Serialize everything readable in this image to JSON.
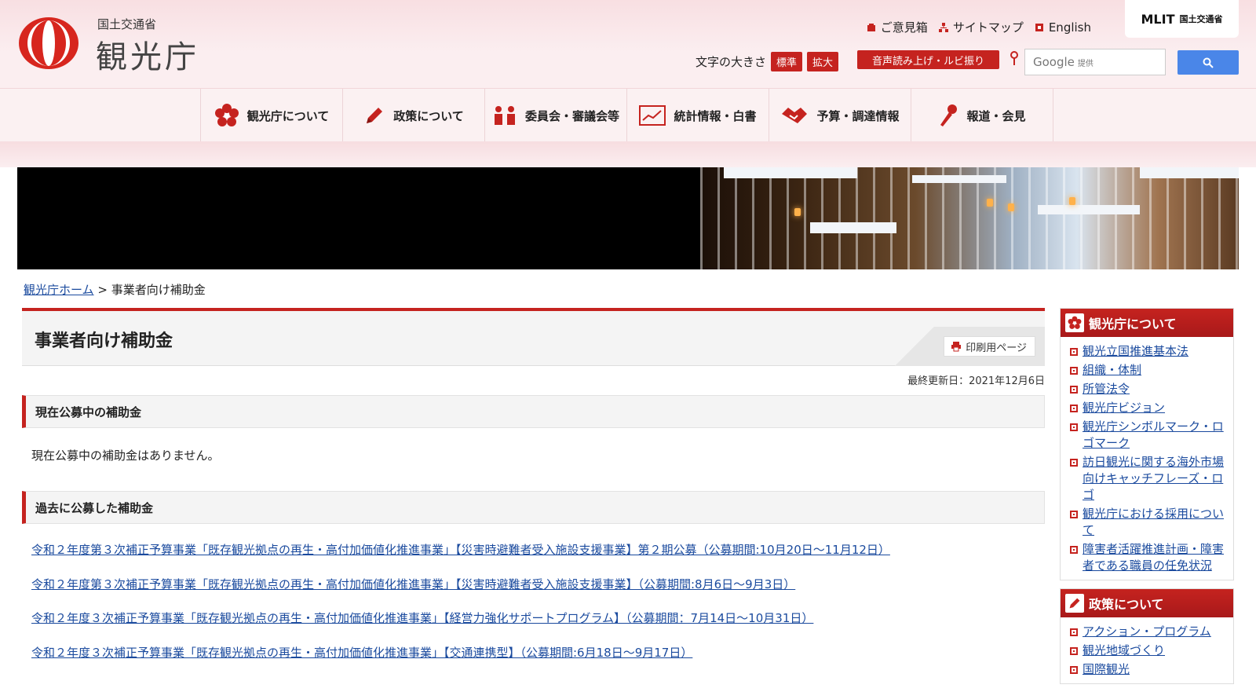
{
  "header": {
    "ministry_label": "国土交通省",
    "agency_name": "観光庁",
    "top_links": [
      "ご意見箱",
      "サイトマップ",
      "English"
    ],
    "mlit_logo_text": "MLIT",
    "mlit_logo_sub": "国土交通省",
    "font_size_label": "文字の大きさ",
    "font_size_standard": "標準",
    "font_size_large": "拡大",
    "speech_button": "音声読み上げ・ルビ振り",
    "search_placeholder_brand": "Google",
    "search_placeholder_suffix": "提供"
  },
  "nav": {
    "items": [
      "観光庁について",
      "政策について",
      "委員会・審議会等",
      "統計情報・白書",
      "予算・調達情報",
      "報道・会見"
    ]
  },
  "breadcrumb": {
    "home": "観光庁ホーム",
    "separator": ">",
    "current": "事業者向け補助金"
  },
  "main": {
    "title": "事業者向け補助金",
    "print_label": "印刷用ページ",
    "last_updated": "最終更新日：2021年12月6日",
    "section1_heading": "現在公募中の補助金",
    "section1_body": "現在公募中の補助金はありません。",
    "section2_heading": "過去に公募した補助金",
    "past_links": [
      "令和２年度第３次補正予算事業「既存観光拠点の再生・高付加価値化推進事業」【災害時避難者受入施設支援事業】第２期公募（公募期間:10月20日～11月12日）",
      "令和２年度第３次補正予算事業「既存観光拠点の再生・高付加価値化推進事業」【災害時避難者受入施設支援事業】（公募期間:8月6日～9月3日）",
      "令和２年度３次補正予算事業「既存観光拠点の再生・高付加価値化推進事業」【経営力強化サポートプログラム】（公募期間：7月14日～10月31日）",
      "令和２年度３次補正予算事業「既存観光拠点の再生・高付加価値化推進事業」【交通連携型】（公募期間:6月18日～9月17日）"
    ]
  },
  "sidebar": {
    "box1_title": "観光庁について",
    "box1_items": [
      "観光立国推進基本法",
      "組織・体制",
      "所管法令",
      "観光庁ビジョン",
      "観光庁シンボルマーク・ロゴマーク",
      "訪日観光に関する海外市場向けキャッチフレーズ・ロゴ",
      "観光庁における採用について",
      "障害者活躍推進計画・障害者である職員の任免状況"
    ],
    "box2_title": "政策について",
    "box2_items": [
      "アクション・プログラム",
      "観光地域づくり",
      "国際観光"
    ]
  },
  "colors": {
    "accent": "#c5231f",
    "link": "#1a4a9e",
    "search_button": "#4a86e8"
  }
}
